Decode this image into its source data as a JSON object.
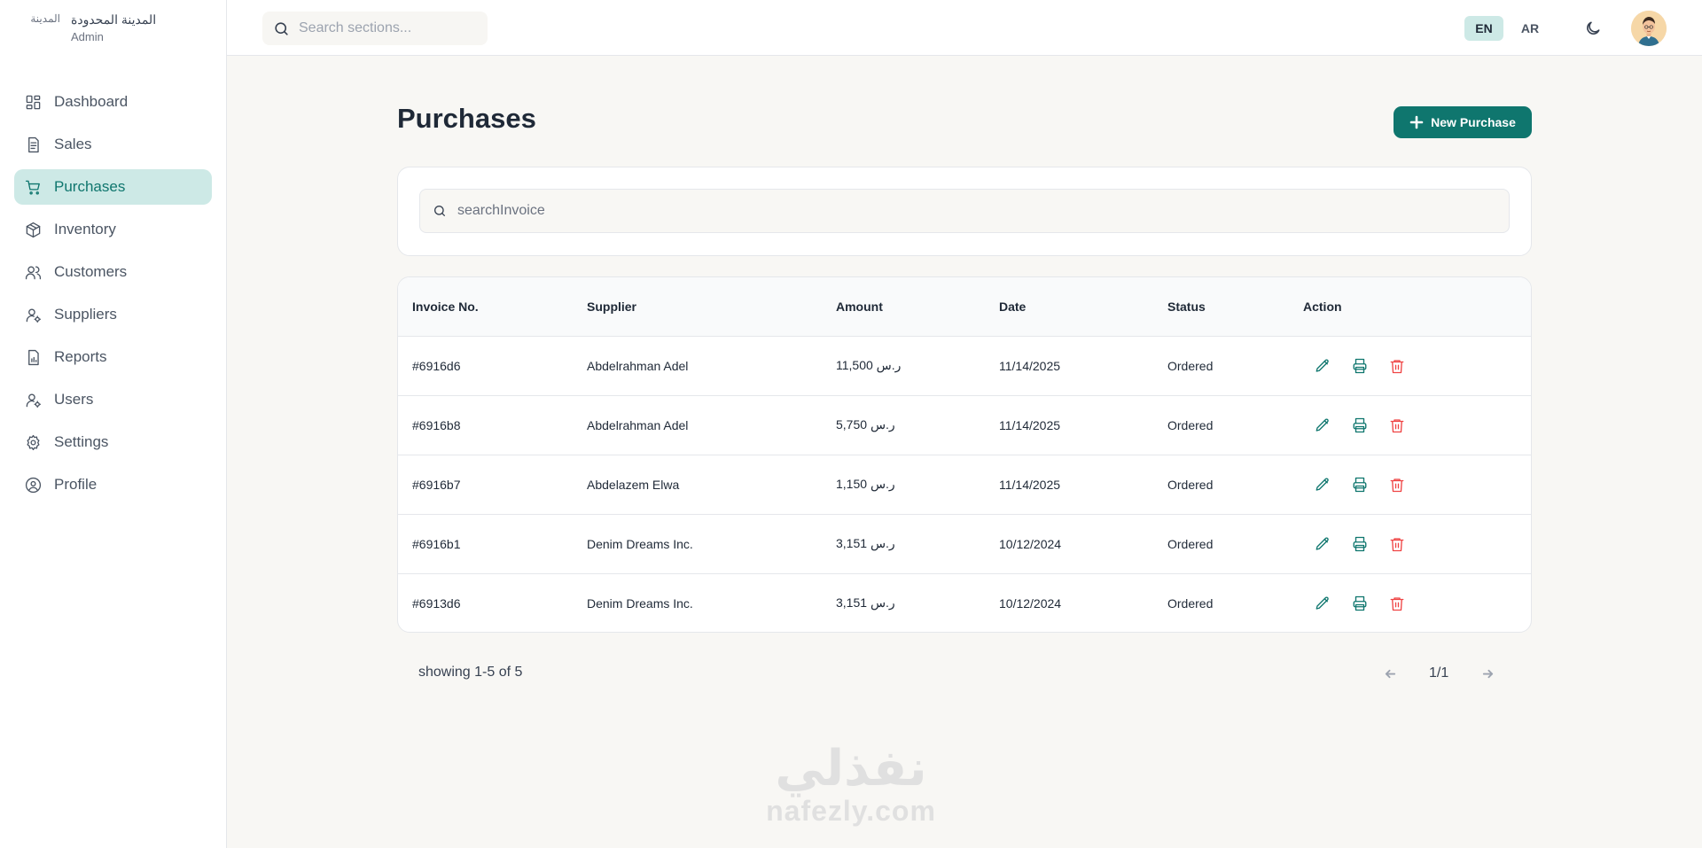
{
  "brand": {
    "logo_alt": "المدينة",
    "name": "المدينة المحدودة",
    "role": "Admin"
  },
  "sidebar": {
    "items": [
      {
        "label": "Dashboard",
        "icon": "dashboard-icon",
        "active": false
      },
      {
        "label": "Sales",
        "icon": "receipt-icon",
        "active": false
      },
      {
        "label": "Purchases",
        "icon": "cart-icon",
        "active": true
      },
      {
        "label": "Inventory",
        "icon": "box-icon",
        "active": false
      },
      {
        "label": "Customers",
        "icon": "users-icon",
        "active": false
      },
      {
        "label": "Suppliers",
        "icon": "user-cog-icon",
        "active": false
      },
      {
        "label": "Reports",
        "icon": "report-icon",
        "active": false
      },
      {
        "label": "Users",
        "icon": "user-cog-icon",
        "active": false
      },
      {
        "label": "Settings",
        "icon": "gear-icon",
        "active": false
      },
      {
        "label": "Profile",
        "icon": "profile-icon",
        "active": false
      }
    ]
  },
  "topbar": {
    "search_placeholder": "Search sections...",
    "lang_en": "EN",
    "lang_ar": "AR",
    "active_lang": "EN"
  },
  "main": {
    "title": "Purchases",
    "new_button": "New Purchase",
    "search_placeholder": "searchInvoice",
    "table": {
      "headers": [
        "Invoice No.",
        "Supplier",
        "Amount",
        "Date",
        "Status",
        "Action"
      ],
      "rows": [
        {
          "invoice": "#6916d6",
          "supplier": "Abdelrahman Adel",
          "amount": "11,500 ر.س",
          "date": "11/14/2025",
          "status": "Ordered"
        },
        {
          "invoice": "#6916b8",
          "supplier": "Abdelrahman Adel",
          "amount": "5,750 ر.س",
          "date": "11/14/2025",
          "status": "Ordered"
        },
        {
          "invoice": "#6916b7",
          "supplier": "Abdelazem Elwa",
          "amount": "1,150 ر.س",
          "date": "11/14/2025",
          "status": "Ordered"
        },
        {
          "invoice": "#6916b1",
          "supplier": "Denim Dreams Inc.",
          "amount": "3,151 ر.س",
          "date": "10/12/2024",
          "status": "Ordered"
        },
        {
          "invoice": "#6913d6",
          "supplier": "Denim Dreams Inc.",
          "amount": "3,151 ر.س",
          "date": "10/12/2024",
          "status": "Ordered"
        }
      ]
    },
    "showing": "showing 1-5 of 5",
    "pagination": "1/1"
  },
  "watermark": {
    "ar": "نفذلي",
    "en": "nafezly.com"
  },
  "colors": {
    "accent": "#0f766e",
    "active_bg": "#cde9e6",
    "danger": "#ef4444",
    "page_bg": "#f8f7f4"
  }
}
